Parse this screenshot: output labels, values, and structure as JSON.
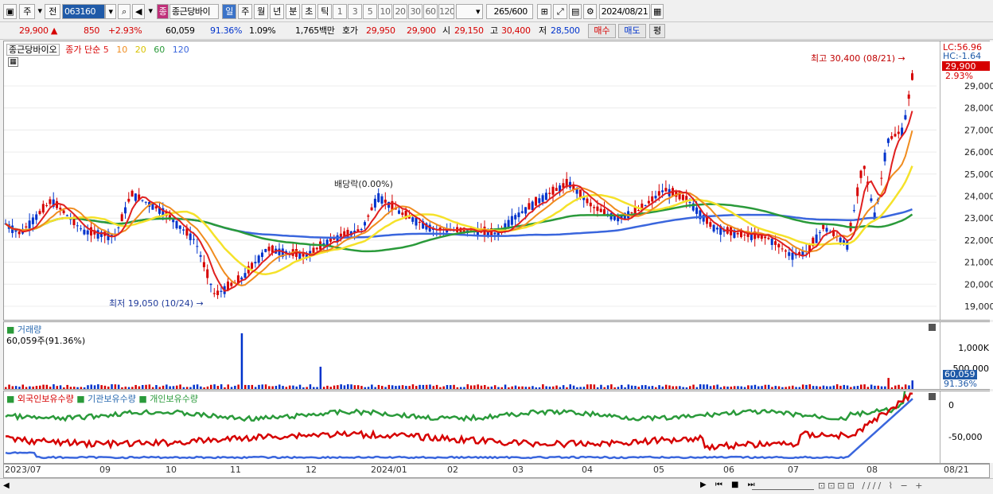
{
  "toolbar": {
    "market_type": "주",
    "prev_label": "전",
    "code": "063160",
    "stock_name": "종근당바이",
    "name_badge": "종",
    "periods": [
      "일",
      "주",
      "월",
      "년",
      "분",
      "초",
      "틱"
    ],
    "active_period": "일",
    "intervals": [
      "1",
      "3",
      "5",
      "10",
      "20",
      "30",
      "60",
      "120"
    ],
    "count_value": "265",
    "count_total": "/600",
    "date": "2024/08/21"
  },
  "quote": {
    "price": "29,900",
    "change": "850",
    "change_pct": "+2.93%",
    "volume": "60,059",
    "volume_ratio": "91.36%",
    "turnover": "1.09%",
    "amount": "1,765백만",
    "ask_label": "호가",
    "ask1": "29,950",
    "ask2": "29,900",
    "open_label": "시",
    "open": "29,150",
    "high_label": "고",
    "high": "30,400",
    "low_label": "저",
    "low": "28,500",
    "buy_label": "매수",
    "sell_label": "매도",
    "avg_label": "평"
  },
  "legend": {
    "stock_tag": "종근당바이오",
    "ma_title": "종가 단순",
    "ma_periods": [
      "5",
      "10",
      "20",
      "60",
      "120"
    ]
  },
  "colors": {
    "up": "#d60000",
    "down": "#0033cc",
    "ma5": "#e02020",
    "ma10": "#f08c1e",
    "ma20": "#f5e22a",
    "ma60": "#2a9a3a",
    "ma120": "#3a66dd"
  },
  "price_chart": {
    "lc": "LC:56.96",
    "hc": "HC:-1.64",
    "last_price_label": "29,900",
    "last_pct_label": "2.93%",
    "yticks": [
      "29,000",
      "28,000",
      "27,000",
      "26,000",
      "25,000",
      "24,000",
      "23,000",
      "22,000",
      "21,000",
      "20,000",
      "19,000"
    ],
    "high_annotation": "최고 30,400 (08/21)",
    "low_annotation": "최저 19,050 (10/24)",
    "dividend_annotation": "배당락(0.00%)"
  },
  "volume_chart": {
    "title": "거래량",
    "value_label": "60,059주(91.36%)",
    "yticks": [
      "1,000K",
      "500,000"
    ],
    "last_label": "60,059",
    "last_pct": "91.36%"
  },
  "holdings_chart": {
    "series": [
      "외국인보유수량",
      "기관보유수량",
      "개인보유수량"
    ],
    "yticks": [
      "0",
      "-50,000"
    ]
  },
  "x_axis": {
    "labels": [
      "2023/07",
      "09",
      "10",
      "11",
      "12",
      "2024/01",
      "02",
      "03",
      "04",
      "05",
      "06",
      "07",
      "08",
      "08/21"
    ]
  }
}
